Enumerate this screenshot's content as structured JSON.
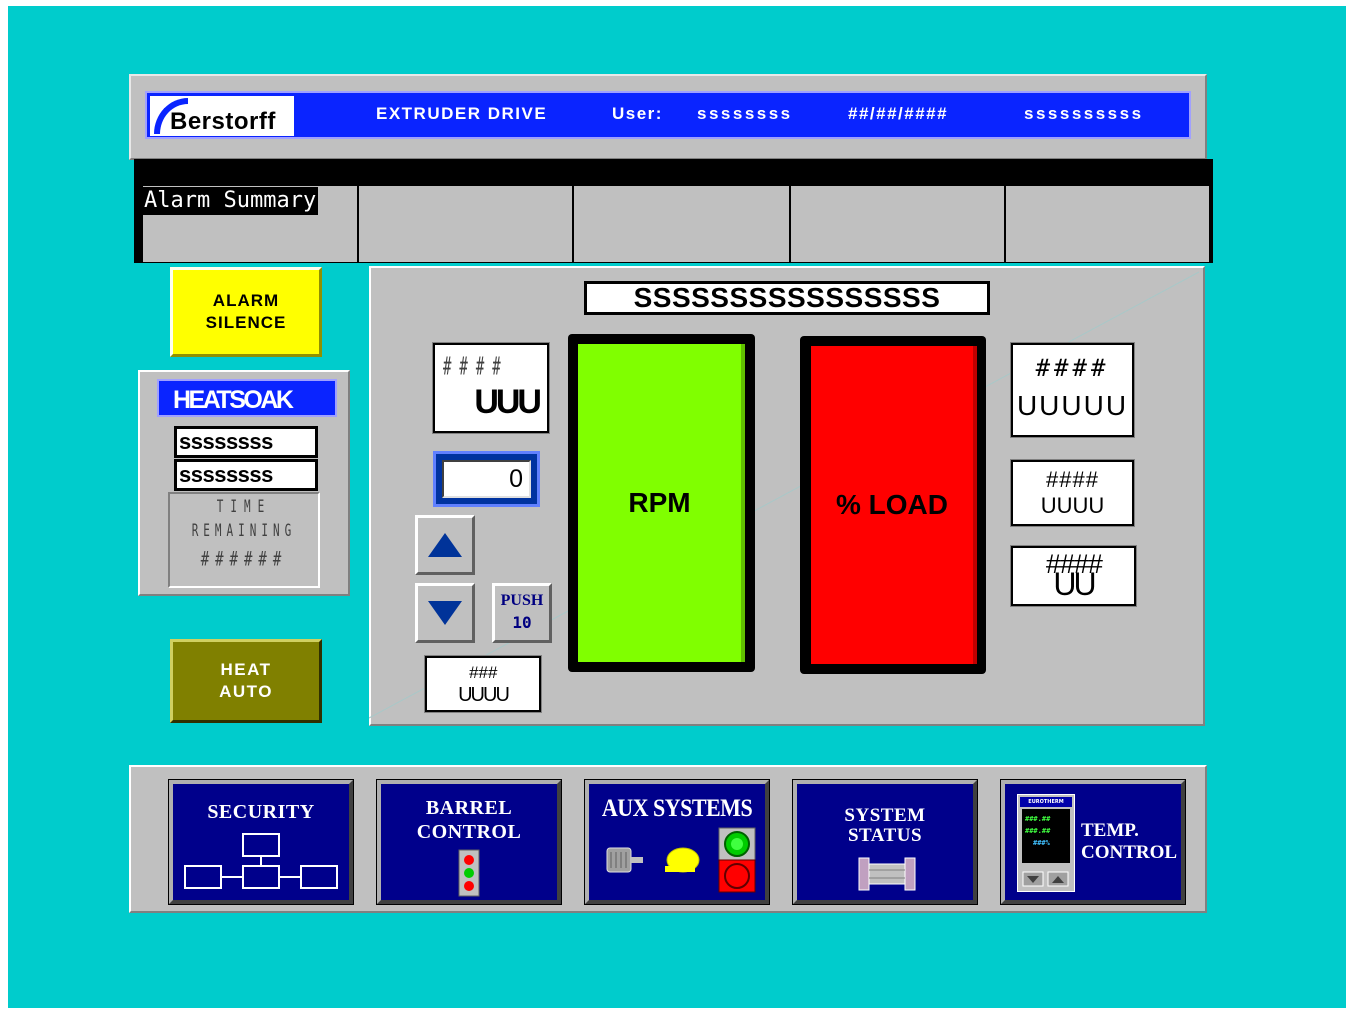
{
  "header": {
    "logo_text": "Berstorff",
    "title": "EXTRUDER DRIVE",
    "user_label": "User:",
    "user_value": "ssssssss",
    "date_value": "##/##/####",
    "info_value": "ssssssssss"
  },
  "alarm_summary": {
    "title": "Alarm Summary"
  },
  "buttons": {
    "alarm_silence_line1": "ALARM",
    "alarm_silence_line2": "SILENCE",
    "heat_auto_line1": "HEAT",
    "heat_auto_line2": "AUTO"
  },
  "heatsoak": {
    "title": "HEATSOAK",
    "field1": "ssssssss",
    "field2": "ssssssss",
    "time_line1": "TIME",
    "time_line2": "REMAINING",
    "time_value": "######"
  },
  "main": {
    "title": "SSSSSSSSSSSSSSSS",
    "left_display": {
      "value": "####",
      "unit": "UUU"
    },
    "setpoint_value": "0",
    "push_label": "PUSH",
    "push_value": "10",
    "bottom_display": {
      "value": "###",
      "unit": "UUUU"
    },
    "rpm_label": "RPM",
    "load_label": "% LOAD",
    "right_display_1": {
      "value": "####",
      "unit": "UUUUU"
    },
    "right_display_2": {
      "value": "####",
      "unit": "UUUU"
    },
    "right_display_3": {
      "value": "####",
      "unit": "UU"
    }
  },
  "nav": {
    "security": "SECURITY",
    "barrel_line1": "BARREL",
    "barrel_line2": "CONTROL",
    "aux": "AUX SYSTEMS",
    "status_line1": "SYSTEM",
    "status_line2": "STATUS",
    "temp_line1": "TEMP.",
    "temp_line2": "CONTROL",
    "eurotherm_brand": "EUROTHERM",
    "eurotherm_line1": "###.##",
    "eurotherm_line2": "###.##",
    "eurotherm_line3": "###%"
  },
  "colors": {
    "background": "#00cccc",
    "title_bar": "#0a24ff",
    "rpm_fill": "#80ff00",
    "load_fill": "#ff0000",
    "alarm_silence": "#ffff00",
    "heat_auto": "#808000",
    "nav_button": "#00008b"
  }
}
